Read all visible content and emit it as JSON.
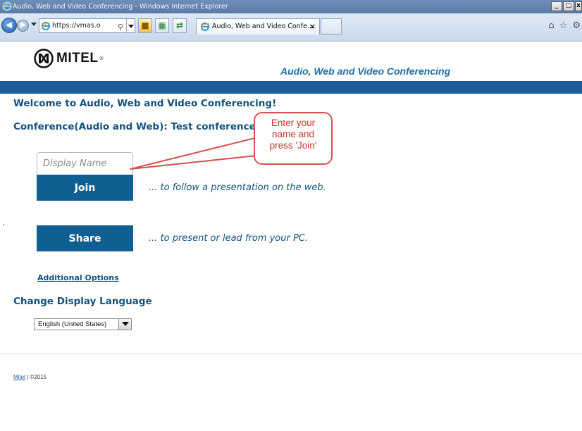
{
  "window": {
    "title": "Audio, Web and Video Conferencing - Windows Internet Explorer",
    "min_label": "_",
    "max_label": "□",
    "close_label": "x"
  },
  "browser": {
    "address_url": "https://vmas.o",
    "tab_label": "Audio, Web and Video Confe...",
    "tab_close": "×"
  },
  "header": {
    "brand": "MITEL",
    "reg_mark": "®",
    "title": "Audio, Web and Video Conferencing"
  },
  "main": {
    "welcome": "Welcome to Audio, Web and Video Conferencing!",
    "conference": "Conference(Audio and Web):  Test conference #7",
    "display_name_placeholder": "Display Name",
    "join_label": "Join",
    "join_desc": "... to follow a presentation on the web.",
    "share_label": "Share",
    "share_desc": "... to present or lead from your PC.",
    "additional_options": "Additional Options",
    "language_heading": "Change Display Language",
    "language_selected": "English (United States)"
  },
  "footer": {
    "link": "Mitel",
    "sep": " | ",
    "copyright": "©2015"
  },
  "callout": {
    "line1": "Enter your",
    "line2": "name and",
    "line3": "press 'Join'"
  },
  "colors": {
    "brand_blue": "#1d5b9a",
    "button_blue": "#0f5f92",
    "heading_blue": "#14527f",
    "callout_red": "#d9534f"
  },
  "icons": [
    "ie-logo-icon",
    "back-icon",
    "forward-icon",
    "search-icon",
    "lock-icon",
    "compat-view-icon",
    "refresh-icon",
    "home-icon",
    "favorites-star-icon",
    "gear-icon"
  ]
}
